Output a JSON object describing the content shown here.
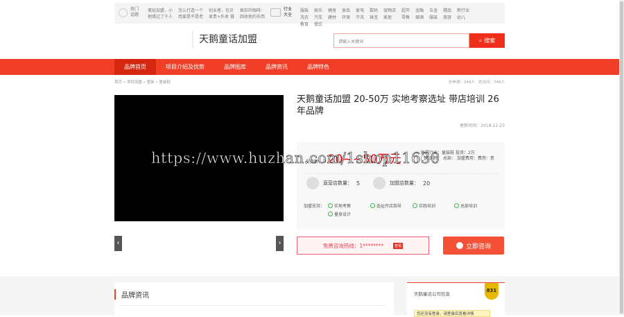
{
  "topbar": {
    "hot_label": "热门话题",
    "hot_links": [
      [
        "蛋挞加盟，小",
        "他错过了千人"
      ],
      [
        "怎么打造一个",
        "用爱是不是老"
      ],
      [
        "创业者，包贝",
        "显贵+外卖 餐"
      ],
      [
        "疯狂的咖啡：",
        "回收他的东西"
      ]
    ],
    "industry_label": "行业大全",
    "categories": [
      "服装",
      "娱乐",
      "健身",
      "食品",
      "家电",
      "数码",
      "宠物店",
      "超市",
      "金融",
      "五金",
      "精品",
      "新行业",
      "洗衣",
      "汽车",
      "建材",
      "环保",
      "干洗",
      "珠宝",
      "家居",
      "零售",
      "烟酒",
      "服装",
      "美容",
      "幼儿",
      "教育",
      "餐饮"
    ]
  },
  "header": {
    "logo": "天鹅童话加盟",
    "search_placeholder": "请输入关键词",
    "search_button": "搜索"
  },
  "nav": {
    "items": [
      "品牌首页",
      "项目介绍及优势",
      "品牌图库",
      "品牌资讯",
      "品牌特色"
    ]
  },
  "breadcrumb": "首页 • 项目加盟 • 童装 • 童装鞋",
  "stats": {
    "apply": "总申请：249人",
    "visits": "总访问：746人"
  },
  "product": {
    "title": "天鹅童话加盟 20-50万 实地考察选址 带店培训 26年品牌",
    "updated": "更新时间：2018-12-23",
    "price_label": "投资额：",
    "price_symbol": "¥",
    "price": "20~~50万元",
    "meta": [
      "所属行业：童装鞋",
      "门店面积：",
      "总部：",
      "加盟费用："
    ],
    "meta_right": [
      "投资：2万",
      "费用：意"
    ],
    "direct_label": "直营店数量：",
    "direct_value": "5",
    "franchise_label": "加盟店数量：",
    "franchise_value": "20",
    "support_label": "加盟支持：",
    "supports": [
      "实地考察",
      "选址开店指导",
      "实践培训",
      "总部培训",
      "量身设计"
    ],
    "hotline": "免费咨询热线：1********",
    "view": "查看",
    "consult": "立即咨询"
  },
  "sections": {
    "news_title": "品牌资讯",
    "company_title": "天鹅童话公司信息",
    "badge": "831",
    "company_note": "您还没有登录，请登录后查看详情"
  },
  "watermark": "https://www.huzhan.com/1shop11630"
}
